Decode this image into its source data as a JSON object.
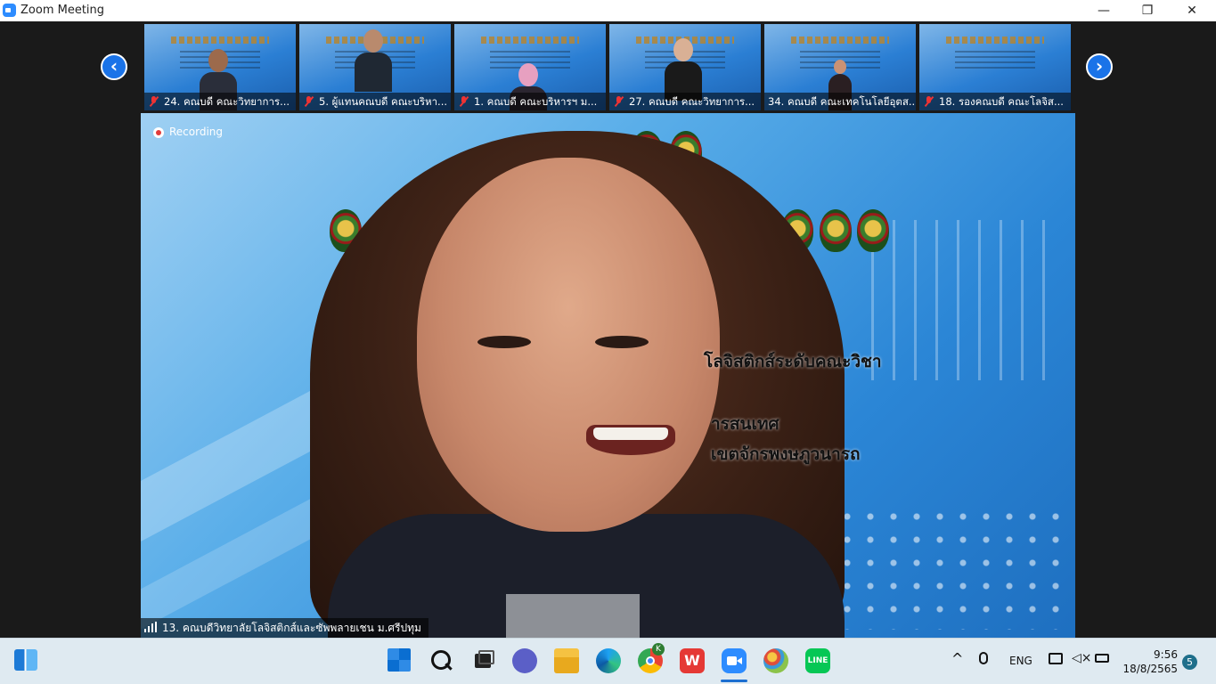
{
  "window": {
    "title": "Zoom Meeting",
    "controls": {
      "minimize": "—",
      "restore": "❐",
      "close": "✕"
    }
  },
  "gallery": {
    "prev_icon": "chevron-left-icon",
    "next_icon": "chevron-right-icon",
    "participants": [
      {
        "label": "24. คณบดี คณะวิทยาการ...",
        "muted": true
      },
      {
        "label": "5. ผู้แทนคณบดี คณะบริหา...",
        "muted": true
      },
      {
        "label": "1. คณบดี คณะบริหารฯ ม...",
        "muted": true
      },
      {
        "label": "27. คณบดี คณะวิทยาการ...",
        "muted": true
      },
      {
        "label": "34. คณบดี คณะเทคโนโลยีอุตส...",
        "muted": false
      },
      {
        "label": "18. รองคณบดี คณะโลจิส...",
        "muted": true
      }
    ]
  },
  "main_video": {
    "recording_label": "Recording",
    "speaker_name": "13. คณบดีวิทยาลัยโลจิสติกส์และซัพพลายเชน ม.ศรีปทุม",
    "slide_lines": [
      "โลจิสติกส์ระดับคณะวิชา",
      "ารสนเทศ",
      "เขตจักรพงษภูวนารถ"
    ]
  },
  "taskbar": {
    "apps": [
      "widgets-icon",
      "windows-start-icon",
      "search-icon",
      "task-view-icon",
      "teams-chat-icon",
      "file-explorer-icon",
      "edge-icon",
      "chrome-icon",
      "wps-office-icon",
      "zoom-icon",
      "paint-icon",
      "line-icon"
    ],
    "chrome_badge": "K",
    "tray": {
      "chevron": "^",
      "language": "ENG",
      "time": "9:56",
      "date": "18/8/2565",
      "notifications": "5"
    }
  },
  "colors": {
    "zoom_blue": "#2D8CFF",
    "nav_arrow": "#1a73e8",
    "recording_red": "#e23b3b",
    "taskbar_bg": "#dfeaf1"
  }
}
